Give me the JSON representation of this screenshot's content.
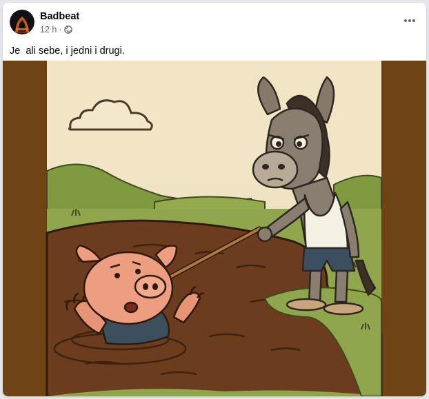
{
  "post": {
    "author": "Badbeat",
    "time": "12 h",
    "separator": "·",
    "privacy_icon": "globe-icon",
    "more_icon": "more-horizontal-icon",
    "text": "Je  ali sebe, i jedni i drugi."
  },
  "colors": {
    "frame": "#6e4417",
    "sky": "#efe3c3",
    "mud": "#6b3d1e",
    "grass": "#8fa64c"
  }
}
